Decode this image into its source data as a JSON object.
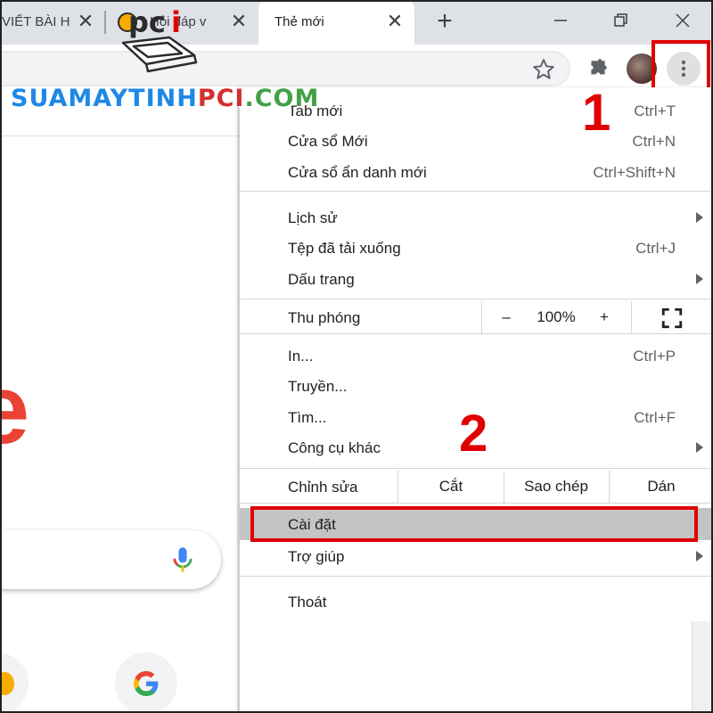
{
  "browser": {
    "tabs": [
      {
        "title": "VIẾT BÀI H"
      },
      {
        "title": "Hỏi đáp v"
      },
      {
        "title": "Thẻ mới"
      }
    ],
    "tab_close_label": "✕",
    "new_tab_label": "+"
  },
  "watermark": {
    "part1": "SUAMAYTINH",
    "part2": "PCI",
    "part3": ".COM",
    "colors": {
      "blue": "#1e88e5",
      "red": "#d32f2f",
      "green": "#43a047"
    }
  },
  "menu": {
    "group1": [
      {
        "label": "Tab mới",
        "shortcut": "Ctrl+T"
      },
      {
        "label": "Cửa sổ Mới",
        "shortcut": "Ctrl+N"
      },
      {
        "label": "Cửa sổ ẩn danh mới",
        "shortcut": "Ctrl+Shift+N"
      }
    ],
    "group2": [
      {
        "label": "Lịch sử"
      },
      {
        "label": "Tệp đã tải xuống",
        "shortcut": "Ctrl+J"
      },
      {
        "label": "Dấu trang"
      }
    ],
    "zoom": {
      "label": "Thu phóng",
      "minus": "–",
      "value": "100%",
      "plus": "+"
    },
    "group3": [
      {
        "label": "In...",
        "shortcut": "Ctrl+P"
      },
      {
        "label": "Truyền..."
      },
      {
        "label": "Tìm...",
        "shortcut": "Ctrl+F"
      },
      {
        "label": "Công cụ khác"
      }
    ],
    "edit": {
      "label": "Chỉnh sửa",
      "cut": "Cắt",
      "copy": "Sao chép",
      "paste": "Dán"
    },
    "group4": [
      {
        "label": "Cài đặt"
      },
      {
        "label": "Trợ giúp"
      }
    ],
    "exit": {
      "label": "Thoát"
    }
  },
  "annotations": {
    "step1": "1",
    "step2": "2",
    "highlight_color": "#e00000"
  },
  "page": {
    "big_letter": "e"
  }
}
